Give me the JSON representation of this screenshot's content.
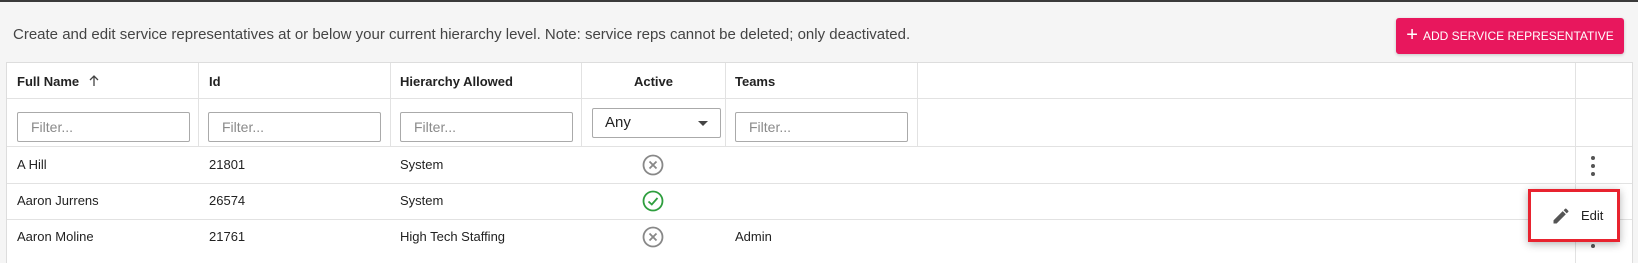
{
  "header": {
    "description": "Create and edit service representatives at or below your current hierarchy level. Note: service reps cannot be deleted; only deactivated.",
    "add_button_label": "ADD SERVICE REPRESENTATIVE",
    "accent_color": "#e8175d"
  },
  "grid": {
    "columns": [
      {
        "label": "Full Name",
        "sort": "ascending"
      },
      {
        "label": "Id"
      },
      {
        "label": "Hierarchy Allowed"
      },
      {
        "label": "Active"
      },
      {
        "label": "Teams"
      }
    ],
    "filters": {
      "full_name_placeholder": "Filter...",
      "id_placeholder": "Filter...",
      "hierarchy_placeholder": "Filter...",
      "active_value": "Any",
      "teams_placeholder": "Filter..."
    },
    "rows": [
      {
        "full_name": "A Hill",
        "id": "21801",
        "hierarchy": "System",
        "active": "inactive",
        "teams": ""
      },
      {
        "full_name": "Aaron Jurrens",
        "id": "26574",
        "hierarchy": "System",
        "active": "active",
        "teams": ""
      },
      {
        "full_name": "Aaron Moline",
        "id": "21761",
        "hierarchy": "High Tech Staffing",
        "active": "inactive",
        "teams": "Admin"
      }
    ]
  },
  "row_menu": {
    "edit_label": "Edit",
    "icon": "pencil-icon"
  },
  "status_colors": {
    "active": "#2e9e3e",
    "inactive": "#888888"
  }
}
